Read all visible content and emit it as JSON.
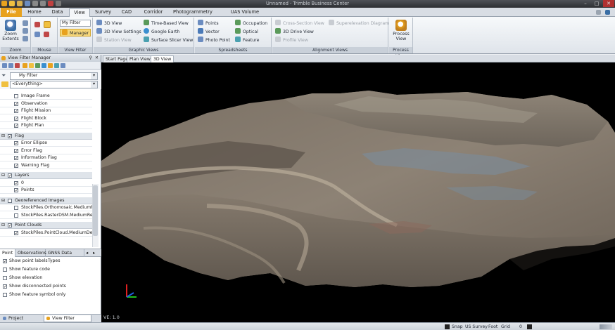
{
  "titlebar": {
    "title": "Unnamed - Trimble Business Center",
    "minimize": "–",
    "maximize": "□",
    "close": "✕"
  },
  "tabs": [
    "File",
    "Home",
    "Data",
    "View",
    "Survey",
    "CAD",
    "Corridor",
    "Photogrammetry",
    "UAS Volume Calculations"
  ],
  "active_tab": "View",
  "ribbon": {
    "zoom": {
      "label": "Zoom",
      "zoom_extents": "Zoom Extents"
    },
    "mouse": {
      "label": "Mouse"
    },
    "view_filter": {
      "label": "View Filter",
      "filter_select": "My Filter",
      "manager": "Manager"
    },
    "graphic_views": {
      "label": "Graphic Views",
      "items": [
        "3D View",
        "Time-Based View",
        "3D View Settings",
        "Google Earth",
        "Station View",
        "Surface Slicer View"
      ]
    },
    "spreadsheets": {
      "label": "Spreadsheets",
      "items": [
        "Points",
        "Occupation",
        "Vector",
        "Optical",
        "Photo Point",
        "Feature"
      ]
    },
    "alignment_views": {
      "label": "Alignment Views",
      "items": [
        "Cross-Section View",
        "Superelevation Diagram",
        "3D Drive View",
        "Profile View"
      ]
    },
    "process": {
      "label": "Process View",
      "button": "Process View"
    }
  },
  "left_panel": {
    "title": "View Filter Manager",
    "pin": "✕",
    "filter_value": "My Filter",
    "scope_value": "<Everything>",
    "rows": [
      {
        "text": "Image Frame",
        "checked": false,
        "section": false
      },
      {
        "text": "Observation",
        "checked": true,
        "section": false
      },
      {
        "text": "Flight Mission",
        "checked": true,
        "section": false
      },
      {
        "text": "Flight Block",
        "checked": true,
        "section": false
      },
      {
        "text": "Flight Plan",
        "checked": true,
        "section": false
      },
      {
        "text": "",
        "checked": false,
        "section": false,
        "spacer": true
      },
      {
        "text": "Flag",
        "checked": true,
        "section": true
      },
      {
        "text": "Error Ellipse",
        "checked": true,
        "section": false
      },
      {
        "text": "Error Flag",
        "checked": true,
        "section": false
      },
      {
        "text": "Information Flag",
        "checked": true,
        "section": false
      },
      {
        "text": "Warning Flag",
        "checked": true,
        "section": false
      },
      {
        "text": "",
        "checked": false,
        "section": false,
        "spacer": true
      },
      {
        "text": "Layers",
        "checked": true,
        "section": true
      },
      {
        "text": "0",
        "checked": true,
        "section": false
      },
      {
        "text": "Points",
        "checked": true,
        "section": false
      },
      {
        "text": "",
        "checked": false,
        "section": false,
        "spacer": true
      },
      {
        "text": "Georeferenced Images",
        "checked": false,
        "section": true
      },
      {
        "text": "StockPiles.Orthomosaic.MediumR",
        "checked": false,
        "section": false
      },
      {
        "text": "StockPiles.RasterDSM.MediumRe",
        "checked": false,
        "section": false
      },
      {
        "text": "",
        "checked": false,
        "section": false,
        "spacer": true
      },
      {
        "text": "Point Clouds",
        "checked": true,
        "section": true
      },
      {
        "text": "StockPiles.PointCloud.MediumDen",
        "checked": true,
        "section": false
      }
    ],
    "subtabs": [
      "Point",
      "Observations",
      "GNSS Data Types"
    ],
    "options": [
      {
        "text": "Show point labels",
        "checked": true
      },
      {
        "text": "Show feature code",
        "checked": false
      },
      {
        "text": "Show elevation",
        "checked": false
      },
      {
        "text": "Show disconnected points",
        "checked": true
      },
      {
        "text": "Show feature symbol only",
        "checked": false
      }
    ],
    "bottom_tabs": [
      "Project Explorer",
      "View Filter Manager"
    ]
  },
  "doc_tabs": [
    "Start Page",
    "Plan View",
    "3D View"
  ],
  "active_doc_tab": "3D View",
  "viewport": {
    "ve_label": "VE: 1.0"
  },
  "status": {
    "snap": "Snap",
    "coord_system": "US Survey",
    "units": "Foot",
    "grid": "Grid",
    "value": "0"
  },
  "colors": {
    "file_tab": "#e8a21e",
    "accent": "#3a6ea5"
  }
}
